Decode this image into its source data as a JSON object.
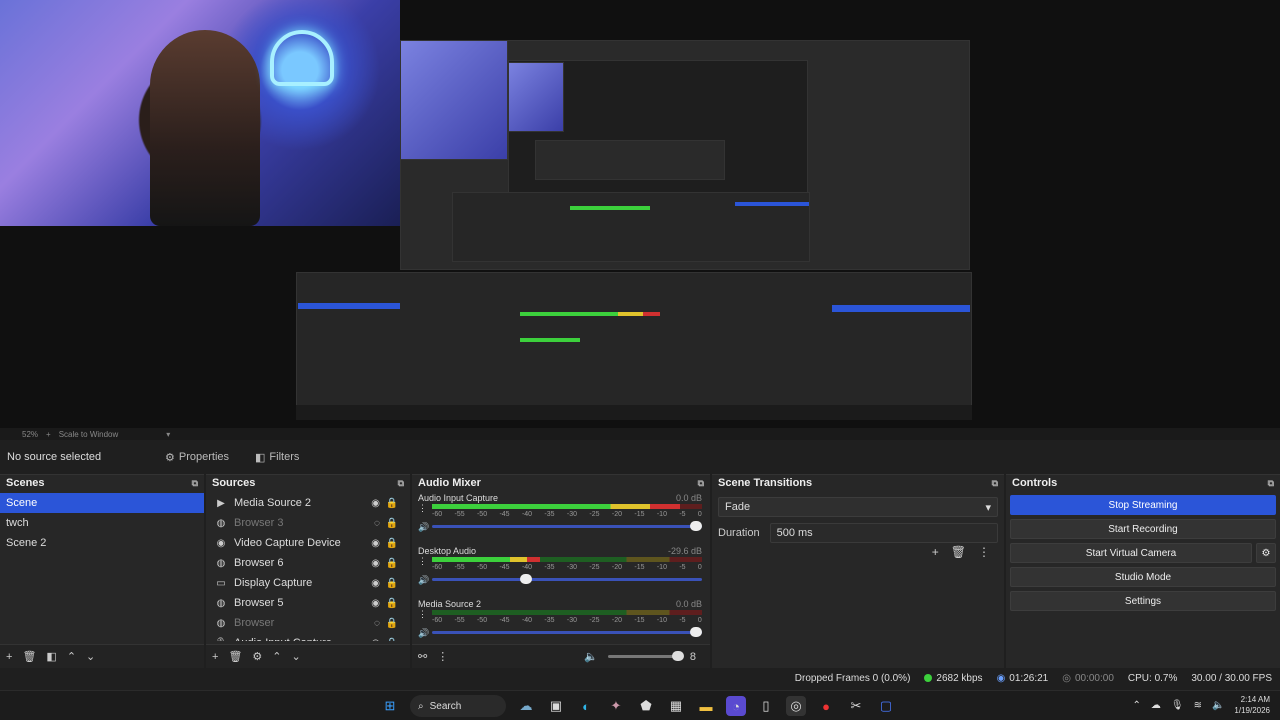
{
  "window": {
    "min": "—",
    "max": "▢",
    "close": "✕"
  },
  "preview": {
    "zoom": "52%",
    "scale_mode": "Scale to Window"
  },
  "toolbar": {
    "no_source": "No source selected",
    "properties": "Properties",
    "filters": "Filters"
  },
  "scenes": {
    "title": "Scenes",
    "items": [
      {
        "label": "Scene",
        "selected": true
      },
      {
        "label": "twch",
        "selected": false
      },
      {
        "label": "Scene 2",
        "selected": false
      }
    ]
  },
  "sources": {
    "title": "Sources",
    "items": [
      {
        "label": "Media Source 2",
        "icon": "▶",
        "hidden": false
      },
      {
        "label": "Browser 3",
        "icon": "◍",
        "hidden": true
      },
      {
        "label": "Video Capture Device",
        "icon": "◉",
        "hidden": false
      },
      {
        "label": "Browser 6",
        "icon": "◍",
        "hidden": false
      },
      {
        "label": "Display Capture",
        "icon": "▭",
        "hidden": false
      },
      {
        "label": "Browser 5",
        "icon": "◍",
        "hidden": false
      },
      {
        "label": "Browser",
        "icon": "◍",
        "hidden": true
      },
      {
        "label": "Audio Input Capture",
        "icon": "🎙",
        "hidden": false
      }
    ]
  },
  "mixer": {
    "title": "Audio Mixer",
    "ticks": [
      "-60",
      "-55",
      "-50",
      "-45",
      "-40",
      "-35",
      "-30",
      "-25",
      "-20",
      "-15",
      "-10",
      "-5",
      "0"
    ],
    "channels": [
      {
        "name": "Audio Input Capture",
        "db": "0.0 dB",
        "level": 0.92,
        "volume": 1.0
      },
      {
        "name": "Desktop Audio",
        "db": "-29.6 dB",
        "level": 0.4,
        "volume": 0.37
      },
      {
        "name": "Media Source 2",
        "db": "0.0 dB",
        "level": 0.0,
        "volume": 1.0
      }
    ],
    "master_value": "8"
  },
  "transitions": {
    "title": "Scene Transitions",
    "selected": "Fade",
    "duration_label": "Duration",
    "duration_value": "500 ms"
  },
  "controls": {
    "title": "Controls",
    "stop_streaming": "Stop Streaming",
    "start_recording": "Start Recording",
    "start_virtual_camera": "Start Virtual Camera",
    "studio_mode": "Studio Mode",
    "settings": "Settings"
  },
  "status": {
    "dropped_frames": "Dropped Frames 0 (0.0%)",
    "bitrate": "2682 kbps",
    "stream_time": "01:26:21",
    "record_time": "00:00:00",
    "cpu": "CPU: 0.7%",
    "fps": "30.00 / 30.00 FPS"
  },
  "taskbar": {
    "search": "Search",
    "time": "2:14 AM",
    "date": "1/19/2026"
  },
  "colors": {
    "accent": "#2b55d8",
    "green": "#3cd03c",
    "yellow": "#e0c32c",
    "red": "#d03030"
  }
}
